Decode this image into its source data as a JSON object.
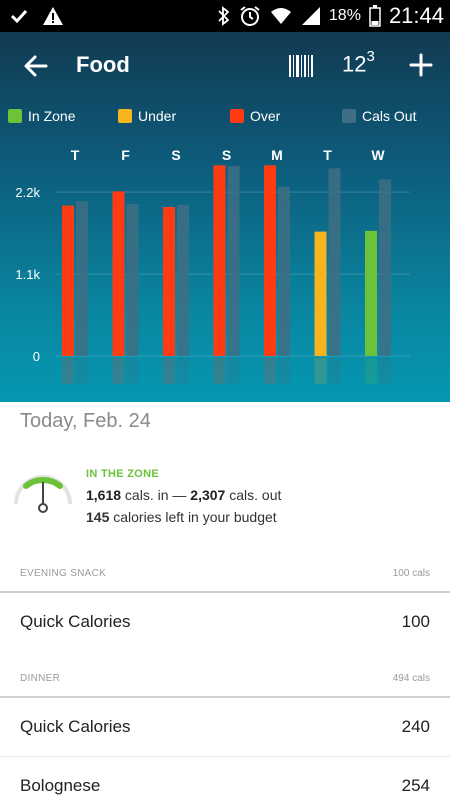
{
  "status_bar": {
    "battery_pct": "18%",
    "time": "21:44",
    "icons": [
      "check-icon",
      "warning-icon",
      "bluetooth-icon",
      "alarm-icon",
      "wifi-icon",
      "signal-icon",
      "battery-icon"
    ]
  },
  "header": {
    "title": "Food",
    "number_button": {
      "base": "12",
      "sup": "3"
    },
    "icons": [
      "back-arrow-icon",
      "barcode-icon",
      "plus-icon"
    ]
  },
  "legend": [
    {
      "label": "In Zone",
      "color": "#6cc33a"
    },
    {
      "label": "Under",
      "color": "#f6b51e"
    },
    {
      "label": "Over",
      "color": "#ff3b14"
    },
    {
      "label": "Cals Out",
      "color": "#3f6f84"
    }
  ],
  "chart_data": {
    "type": "bar",
    "categories": [
      "T",
      "F",
      "S",
      "S",
      "M",
      "T",
      "W"
    ],
    "ylim": [
      0,
      2900
    ],
    "y_ticks": [
      "0",
      "1.1k",
      "2.2k"
    ],
    "y_tick_values": [
      0,
      1100,
      2200
    ],
    "grid": true,
    "series": [
      {
        "name": "Food",
        "values": [
          2020,
          2210,
          2000,
          2560,
          2560,
          1670,
          1680
        ],
        "status": [
          "over",
          "over",
          "over",
          "over",
          "over",
          "under",
          "in_zone"
        ]
      },
      {
        "name": "Cals Out",
        "values": [
          2080,
          2040,
          2030,
          2550,
          2270,
          2520,
          2370
        ]
      }
    ]
  },
  "summary": {
    "date": "Today, Feb. 24",
    "zone_label": "IN THE ZONE",
    "cals_in": "1,618",
    "cals_in_suffix": " cals. in — ",
    "cals_out": "2,307",
    "cals_out_suffix": " cals. out",
    "left": "145",
    "left_suffix": " calories left in your budget"
  },
  "meals": [
    {
      "name": "EVENING SNACK",
      "cals": "100 cals",
      "items": [
        {
          "name": "Quick Calories",
          "value": "100"
        }
      ]
    },
    {
      "name": "DINNER",
      "cals": "494 cals",
      "items": [
        {
          "name": "Quick Calories",
          "value": "240"
        },
        {
          "name": "Bolognese",
          "value": "254"
        }
      ]
    }
  ],
  "colors": {
    "in_zone": "#6cc33a",
    "under": "#f6b51e",
    "over": "#ff3b14",
    "cals_out": "#3f6f84"
  }
}
